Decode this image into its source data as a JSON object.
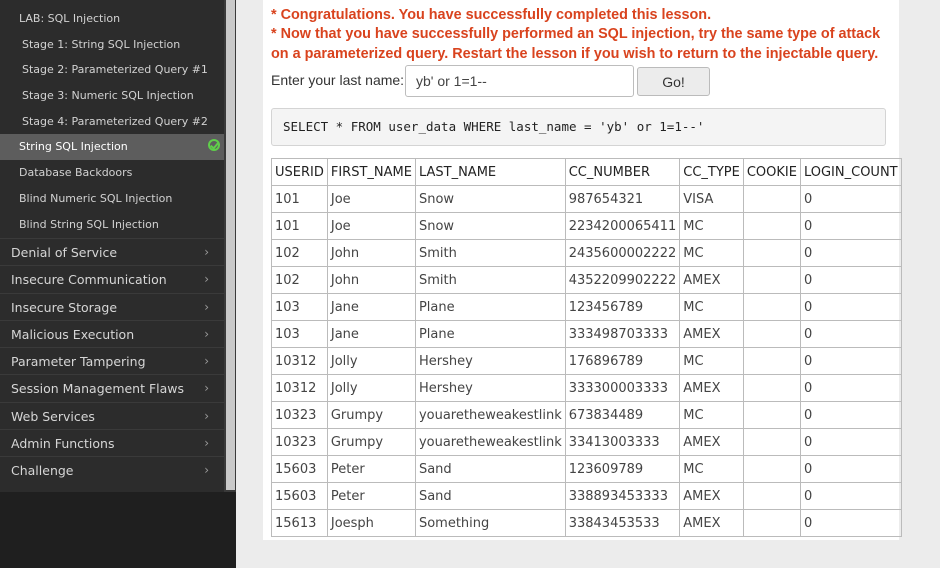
{
  "sidebar": {
    "sub_items": [
      {
        "label": "LAB: SQL Injection",
        "type": "lab"
      },
      {
        "label": "Stage 1: String SQL Injection",
        "type": "stage"
      },
      {
        "label": "Stage 2: Parameterized Query #1",
        "type": "stage"
      },
      {
        "label": "Stage 3: Numeric SQL Injection",
        "type": "stage"
      },
      {
        "label": "Stage 4: Parameterized Query #2",
        "type": "stage"
      },
      {
        "label": "String SQL Injection",
        "type": "lesson",
        "active": true,
        "completed": true
      },
      {
        "label": "Database Backdoors",
        "type": "lesson"
      },
      {
        "label": "Blind Numeric SQL Injection",
        "type": "lesson"
      },
      {
        "label": "Blind String SQL Injection",
        "type": "lesson"
      }
    ],
    "categories": [
      "Denial of Service",
      "Insecure Communication",
      "Insecure Storage",
      "Malicious Execution",
      "Parameter Tampering",
      "Session Management Flaws",
      "Web Services",
      "Admin Functions",
      "Challenge"
    ],
    "chevron": "›",
    "icons": {
      "completed": "check-circle-icon",
      "expand": "chevron-right-icon"
    }
  },
  "main": {
    "messages": [
      "* Congratulations. You have successfully completed this lesson.",
      "* Now that you have successfully performed an SQL injection, try the same type of attack on a parameterized query. Restart the lesson if you wish to return to the injectable query."
    ],
    "form": {
      "label": "Enter your last name:",
      "value": "yb' or 1=1--",
      "button": "Go!"
    },
    "query": "SELECT * FROM user_data WHERE last_name = 'yb' or 1=1--'",
    "table": {
      "headers": [
        "USERID",
        "FIRST_NAME",
        "LAST_NAME",
        "CC_NUMBER",
        "CC_TYPE",
        "COOKIE",
        "LOGIN_COUNT"
      ],
      "rows": [
        [
          "101",
          "Joe",
          "Snow",
          "987654321",
          "VISA",
          "",
          "0"
        ],
        [
          "101",
          "Joe",
          "Snow",
          "2234200065411",
          "MC",
          "",
          "0"
        ],
        [
          "102",
          "John",
          "Smith",
          "2435600002222",
          "MC",
          "",
          "0"
        ],
        [
          "102",
          "John",
          "Smith",
          "4352209902222",
          "AMEX",
          "",
          "0"
        ],
        [
          "103",
          "Jane",
          "Plane",
          "123456789",
          "MC",
          "",
          "0"
        ],
        [
          "103",
          "Jane",
          "Plane",
          "333498703333",
          "AMEX",
          "",
          "0"
        ],
        [
          "10312",
          "Jolly",
          "Hershey",
          "176896789",
          "MC",
          "",
          "0"
        ],
        [
          "10312",
          "Jolly",
          "Hershey",
          "333300003333",
          "AMEX",
          "",
          "0"
        ],
        [
          "10323",
          "Grumpy",
          "youaretheweakestlink",
          "673834489",
          "MC",
          "",
          "0"
        ],
        [
          "10323",
          "Grumpy",
          "youaretheweakestlink",
          "33413003333",
          "AMEX",
          "",
          "0"
        ],
        [
          "15603",
          "Peter",
          "Sand",
          "123609789",
          "MC",
          "",
          "0"
        ],
        [
          "15603",
          "Peter",
          "Sand",
          "338893453333",
          "AMEX",
          "",
          "0"
        ],
        [
          "15613",
          "Joesph",
          "Something",
          "33843453533",
          "AMEX",
          "",
          "0"
        ]
      ]
    },
    "colors": {
      "message": "#d9431e",
      "check": "#5fce4a",
      "sidebar_bg": "#2c2c2c",
      "active_item": "#5d5d5d"
    }
  }
}
